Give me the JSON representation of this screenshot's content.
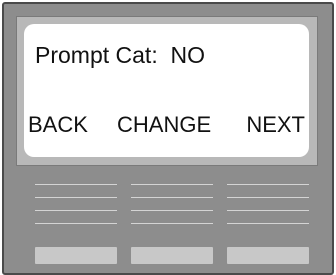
{
  "screen": {
    "prompt_label": "Prompt Cat:",
    "prompt_value": "NO"
  },
  "softkeys": {
    "back": "BACK",
    "change": "CHANGE",
    "next": "NEXT"
  },
  "colors": {
    "device_body": "#8d8d8d",
    "screen_background": "#ffffff",
    "button": "#c8c8c8"
  }
}
